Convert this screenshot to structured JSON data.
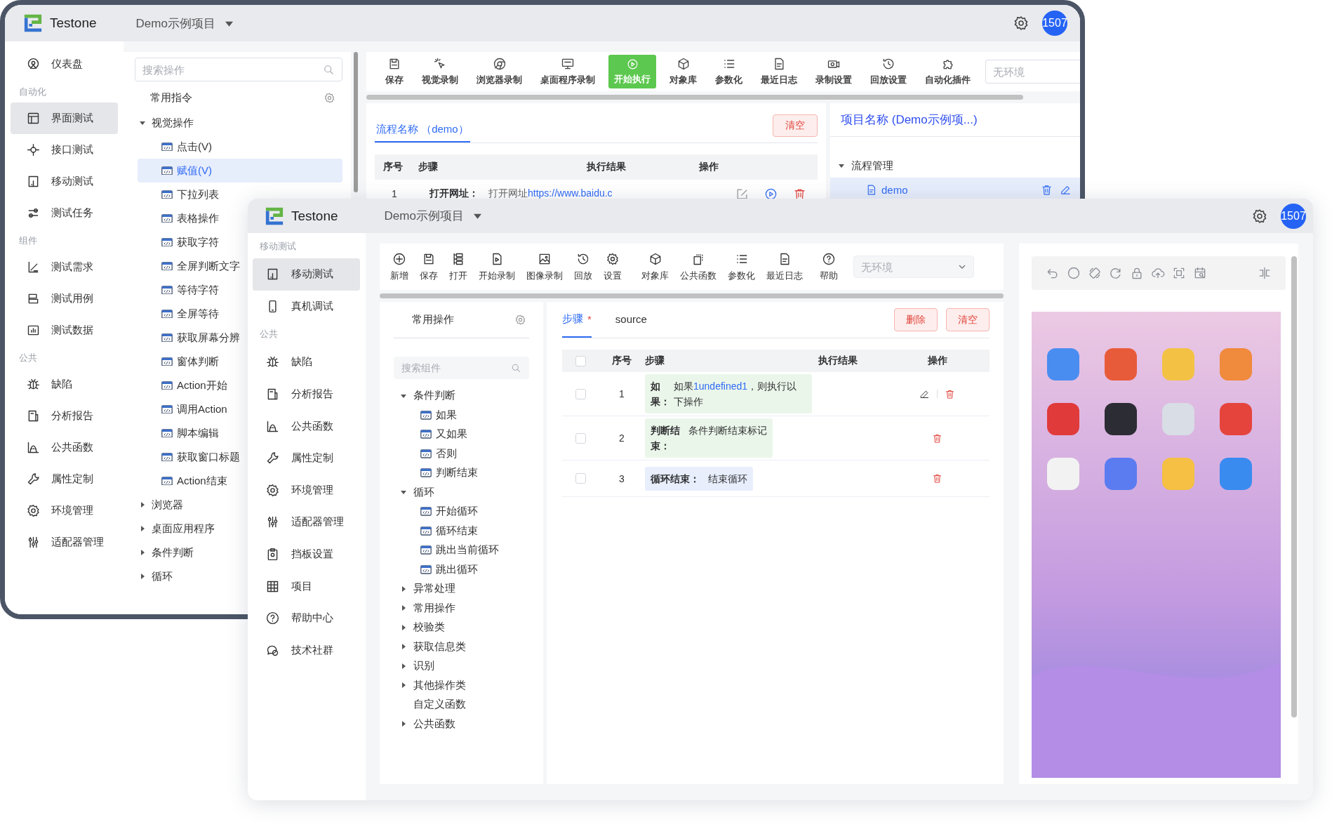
{
  "back_window": {
    "header": {
      "app_name": "Testone",
      "project": "Demo示例项目",
      "avatar": "1507"
    },
    "sidebar": [
      {
        "kind": "item",
        "label": "仪表盘",
        "selected": false
      },
      {
        "kind": "group",
        "label": "自动化"
      },
      {
        "kind": "item",
        "label": "界面测试",
        "selected": true
      },
      {
        "kind": "item",
        "label": "接口测试",
        "selected": false
      },
      {
        "kind": "item",
        "label": "移动测试",
        "selected": false
      },
      {
        "kind": "item",
        "label": "测试任务",
        "selected": false
      },
      {
        "kind": "group",
        "label": "组件"
      },
      {
        "kind": "item",
        "label": "测试需求",
        "selected": false
      },
      {
        "kind": "item",
        "label": "测试用例",
        "selected": false
      },
      {
        "kind": "item",
        "label": "测试数据",
        "selected": false
      },
      {
        "kind": "group",
        "label": "公共"
      },
      {
        "kind": "item",
        "label": "缺陷",
        "selected": false
      },
      {
        "kind": "item",
        "label": "分析报告",
        "selected": false
      },
      {
        "kind": "item",
        "label": "公共函数",
        "selected": false
      },
      {
        "kind": "item",
        "label": "属性定制",
        "selected": false
      },
      {
        "kind": "item",
        "label": "环境管理",
        "selected": false
      },
      {
        "kind": "item",
        "label": "适配器管理",
        "selected": false
      }
    ],
    "operations": {
      "search": {
        "placeholder": "搜索操作"
      },
      "title": "常用指令",
      "tree": [
        {
          "kind": "folder",
          "label": "视觉操作",
          "expanded": true,
          "children": [
            {
              "kind": "component",
              "label": "点击(V)",
              "selected": false
            },
            {
              "kind": "component",
              "label": "赋值(V)",
              "selected": true
            },
            {
              "kind": "component",
              "label": "下拉列表",
              "selected": false
            },
            {
              "kind": "component",
              "label": "表格操作",
              "selected": false
            },
            {
              "kind": "component",
              "label": "获取字符",
              "selected": false
            },
            {
              "kind": "component",
              "label": "全屏判断文字",
              "selected": false
            },
            {
              "kind": "component",
              "label": "等待字符",
              "selected": false
            },
            {
              "kind": "component",
              "label": "全屏等待",
              "selected": false
            },
            {
              "kind": "component",
              "label": "获取屏幕分辨",
              "selected": false
            },
            {
              "kind": "component",
              "label": "窗体判断",
              "selected": false
            },
            {
              "kind": "component",
              "label": "Action开始",
              "selected": false
            },
            {
              "kind": "component",
              "label": "调用Action",
              "selected": false
            },
            {
              "kind": "component",
              "label": "脚本编辑",
              "selected": false
            },
            {
              "kind": "component",
              "label": "获取窗口标题",
              "selected": false
            },
            {
              "kind": "component",
              "label": "Action结束",
              "selected": false
            }
          ]
        },
        {
          "kind": "folder",
          "label": "浏览器",
          "expanded": false
        },
        {
          "kind": "folder",
          "label": "桌面应用程序",
          "expanded": false
        },
        {
          "kind": "folder",
          "label": "条件判断",
          "expanded": false
        },
        {
          "kind": "folder",
          "label": "循环",
          "expanded": false
        }
      ]
    },
    "toolbar": [
      {
        "kind": "tool",
        "label": "保存"
      },
      {
        "kind": "tool",
        "label": "视觉录制"
      },
      {
        "kind": "tool",
        "label": "浏览器录制"
      },
      {
        "kind": "tool",
        "label": "桌面程序录制"
      },
      {
        "kind": "primary",
        "label": "开始执行"
      },
      {
        "kind": "tool",
        "label": "对象库"
      },
      {
        "kind": "tool",
        "label": "参数化"
      },
      {
        "kind": "tool",
        "label": "最近日志"
      },
      {
        "kind": "tool",
        "label": "录制设置"
      },
      {
        "kind": "tool",
        "label": "回放设置"
      },
      {
        "kind": "tool",
        "label": "自动化插件"
      }
    ],
    "environment": {
      "placeholder": "无环境"
    },
    "flow": {
      "tabs": [
        {
          "label": "流程名称 （demo）",
          "selected": true
        }
      ],
      "clear_button": "清空",
      "columns": [
        "序号",
        "步骤",
        "执行结果",
        "操作"
      ],
      "rows": [
        {
          "index": "1",
          "step_label": "打开网址：",
          "step_text": "打开网址",
          "step_link": "https://www.baidu.c"
        }
      ]
    },
    "project": {
      "title": "项目名称 (Demo示例项...)",
      "tree": [
        {
          "label": "流程管理",
          "expanded": true,
          "children": [
            {
              "label": "demo",
              "selected": true
            }
          ]
        }
      ]
    }
  },
  "front_window": {
    "header": {
      "app_name": "Testone",
      "project": "Demo示例项目",
      "avatar": "1507"
    },
    "sidebar": [
      {
        "kind": "group",
        "label": "移动测试"
      },
      {
        "kind": "item",
        "label": "移动测试",
        "selected": true
      },
      {
        "kind": "item",
        "label": "真机调试",
        "selected": false
      },
      {
        "kind": "group",
        "label": "公共"
      },
      {
        "kind": "item",
        "label": "缺陷",
        "selected": false
      },
      {
        "kind": "item",
        "label": "分析报告",
        "selected": false
      },
      {
        "kind": "item",
        "label": "公共函数",
        "selected": false
      },
      {
        "kind": "item",
        "label": "属性定制",
        "selected": false
      },
      {
        "kind": "item",
        "label": "环境管理",
        "selected": false
      },
      {
        "kind": "item",
        "label": "适配器管理",
        "selected": false
      },
      {
        "kind": "item",
        "label": "挡板设置",
        "selected": false
      },
      {
        "kind": "item",
        "label": "项目",
        "selected": false
      },
      {
        "kind": "item",
        "label": "帮助中心",
        "selected": false
      },
      {
        "kind": "item",
        "label": "技术社群",
        "selected": false
      }
    ],
    "toolbar": [
      {
        "kind": "tool",
        "label": "新增"
      },
      {
        "kind": "tool",
        "label": "保存"
      },
      {
        "kind": "tool",
        "label": "打开"
      },
      {
        "kind": "tool",
        "label": "开始录制"
      },
      {
        "kind": "tool",
        "label": "图像录制"
      },
      {
        "kind": "tool",
        "label": "回放"
      },
      {
        "kind": "tool",
        "label": "设置"
      },
      {
        "kind": "tool",
        "label": "对象库"
      },
      {
        "kind": "tool",
        "label": "公共函数"
      },
      {
        "kind": "tool",
        "label": "参数化"
      },
      {
        "kind": "tool",
        "label": "最近日志"
      },
      {
        "kind": "tool",
        "label": "帮助"
      }
    ],
    "environment": {
      "placeholder": "无环境"
    },
    "components": {
      "title": "常用操作",
      "search": {
        "placeholder": "搜索组件"
      },
      "tree": [
        {
          "kind": "folder",
          "label": "条件判断",
          "expanded": true,
          "children": [
            {
              "kind": "component",
              "label": "如果",
              "selected": false
            },
            {
              "kind": "component",
              "label": "又如果",
              "selected": false
            },
            {
              "kind": "component",
              "label": "否则",
              "selected": false
            },
            {
              "kind": "component",
              "label": "判断结束",
              "selected": false
            }
          ]
        },
        {
          "kind": "folder",
          "label": "循环",
          "expanded": true,
          "children": [
            {
              "kind": "component",
              "label": "开始循环",
              "selected": false
            },
            {
              "kind": "component",
              "label": "循环结束",
              "selected": false
            },
            {
              "kind": "component",
              "label": "跳出当前循环",
              "selected": false
            },
            {
              "kind": "component",
              "label": "跳出循环",
              "selected": false
            }
          ]
        },
        {
          "kind": "folder",
          "label": "异常处理",
          "expanded": false
        },
        {
          "kind": "folder",
          "label": "常用操作",
          "expanded": false
        },
        {
          "kind": "folder",
          "label": "校验类",
          "expanded": false
        },
        {
          "kind": "folder",
          "label": "获取信息类",
          "expanded": false
        },
        {
          "kind": "folder",
          "label": "识别",
          "expanded": false
        },
        {
          "kind": "folder",
          "label": "其他操作类",
          "expanded": false
        },
        {
          "kind": "label",
          "label": "自定义函数"
        },
        {
          "kind": "folder",
          "label": "公共函数",
          "expanded": false
        }
      ]
    },
    "steps": {
      "tabs": [
        {
          "label": "步骤",
          "badge": "*",
          "selected": true
        },
        {
          "label": "source",
          "selected": false
        }
      ],
      "buttons": [
        {
          "label": "删除"
        },
        {
          "label": "清空"
        }
      ],
      "header_checked": false,
      "columns": [
        "序号",
        "步骤",
        "执行结果",
        "操作"
      ],
      "rows": [
        {
          "checked": false,
          "index": "1",
          "step_label": "如果：",
          "step_text": "如果",
          "step_value": "1undefined1",
          "step_text_after": "，则执行以下操作",
          "color": "#ebf6ea",
          "editable": true
        },
        {
          "checked": false,
          "index": "2",
          "step_label": "判断结束：",
          "step_text": "条件判断结束标记",
          "color": "#ebf6ea",
          "editable": false
        },
        {
          "checked": false,
          "index": "3",
          "step_label": "循环结束：",
          "step_text": "结束循环",
          "color": "#e8eefc",
          "editable": false
        }
      ]
    }
  }
}
